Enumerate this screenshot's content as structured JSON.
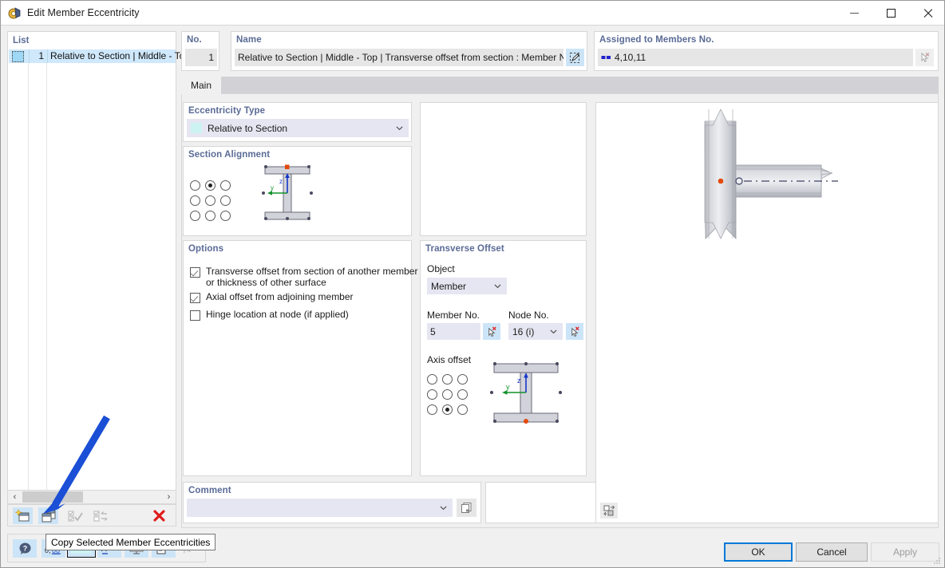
{
  "window": {
    "title": "Edit Member Eccentricity",
    "icon": "eccentricity-icon",
    "minimize_label": "–",
    "maximize_label": "□",
    "close_label": "✕"
  },
  "list": {
    "header": "List",
    "rows": [
      {
        "no": "1",
        "text": "Relative to Section | Middle - To"
      }
    ],
    "scroll_left": "‹",
    "scroll_right": "›",
    "toolbar": [
      {
        "name": "new-member-eccentricity-button",
        "icon": "new-icon",
        "enabled": true
      },
      {
        "name": "copy-selected-member-eccentricities-button",
        "icon": "copy-icon",
        "enabled": true
      },
      {
        "name": "select-all-button",
        "icon": "check-all-icon",
        "enabled": false
      },
      {
        "name": "invert-selection-button",
        "icon": "invert-selection-icon",
        "enabled": false
      },
      {
        "name": "delete-button",
        "icon": "red-x-icon",
        "enabled": true
      }
    ]
  },
  "number": {
    "label": "No.",
    "value": "1"
  },
  "name": {
    "label": "Name",
    "value": "Relative to Section | Middle - Top | Transverse offset from section : Member No",
    "edit_icon": "edit-pencil-icon"
  },
  "assigned": {
    "label": "Assigned to Members No.",
    "value": "4,10,11",
    "member_icon": "member-bars-icon",
    "pick_icon": "pick-cursor-icon"
  },
  "tabs": [
    {
      "label": "Main",
      "active": true
    }
  ],
  "eccentricity_type": {
    "label": "Eccentricity Type",
    "value": "Relative to Section",
    "swatch_color": "#ccf2f2",
    "chevron": "chevron-down-icon"
  },
  "section_alignment": {
    "label": "Section Alignment",
    "grid": [
      [
        false,
        true,
        false
      ],
      [
        false,
        false,
        false
      ],
      [
        false,
        false,
        false
      ]
    ],
    "diagram": "i-beam-section-top-middle"
  },
  "options": {
    "label": "Options",
    "items": [
      {
        "label": "Transverse offset from section of another member",
        "label2": "or thickness of other surface",
        "checked": true
      },
      {
        "label": "Axial offset from adjoining member",
        "label2": "",
        "checked": true
      },
      {
        "label": "Hinge location at node (if applied)",
        "label2": "",
        "checked": false
      }
    ]
  },
  "transverse_offset": {
    "label": "Transverse Offset",
    "object_label": "Object",
    "object_value": "Member",
    "member_no_label": "Member No.",
    "member_no_value": "5",
    "member_pick_icon": "pick-cursor-icon",
    "node_no_label": "Node No.",
    "node_no_value": "16 (i)",
    "node_pick_icon": "pick-cursor-icon",
    "axis_offset_label": "Axis offset",
    "axis_grid": [
      [
        false,
        false,
        false
      ],
      [
        false,
        false,
        false
      ],
      [
        false,
        true,
        false
      ]
    ],
    "diagram": "i-beam-section-bottom-middle"
  },
  "comment": {
    "label": "Comment",
    "value": "",
    "chevron": "chevron-down-icon",
    "copy_icon": "copy-comment-icon"
  },
  "preview": {
    "render_icon": "render-settings-icon",
    "description": "Column with beam eccentric connection"
  },
  "statusbar": {
    "buttons": [
      {
        "name": "help-button",
        "icon": "question-bubble-icon",
        "active": true
      },
      {
        "name": "units-button",
        "icon": "units-icon",
        "active": true
      },
      {
        "name": "color-button",
        "icon": "color-swatch-icon",
        "active": true
      },
      {
        "name": "text-button",
        "icon": "text-style-icon",
        "active": true
      },
      {
        "name": "display-button",
        "icon": "display-icon",
        "active": true
      },
      {
        "name": "report-button",
        "icon": "report-icon",
        "active": true
      },
      {
        "name": "formula-button",
        "icon": "formula-icon",
        "active": false
      }
    ]
  },
  "tooltip": {
    "text": "Copy Selected Member Eccentricities"
  },
  "dialog_buttons": {
    "ok": "OK",
    "cancel": "Cancel",
    "apply": "Apply"
  },
  "annotation": {
    "arrow_color": "#1a4fd6",
    "target": "copy-selected-member-eccentricities-button"
  }
}
